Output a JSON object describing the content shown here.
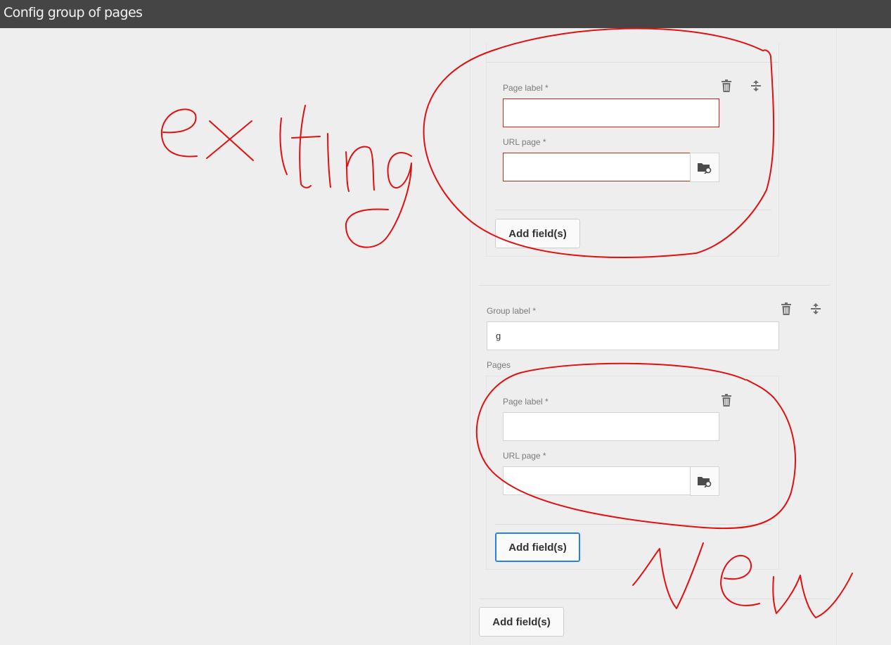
{
  "window": {
    "title": "Config group of pages"
  },
  "existing_page": {
    "page_label": {
      "label": "Page label *",
      "value": ""
    },
    "url_page": {
      "label": "URL page *",
      "value": ""
    },
    "add_button": "Add field(s)"
  },
  "group": {
    "group_label": {
      "label": "Group label *",
      "value": "g"
    },
    "pages_label": "Pages",
    "page": {
      "page_label": {
        "label": "Page label *",
        "value": ""
      },
      "url_page": {
        "label": "URL page *",
        "value": ""
      }
    },
    "add_button": "Add field(s)"
  },
  "outer_add_button": "Add field(s)",
  "annotations": {
    "existing": "exiting",
    "new": "new"
  },
  "colors": {
    "error": "#c8281e",
    "focus": "#2680eb",
    "annotation": "#e01010"
  },
  "icons": [
    "trash-icon",
    "reorder-icon",
    "folder-search-icon"
  ]
}
